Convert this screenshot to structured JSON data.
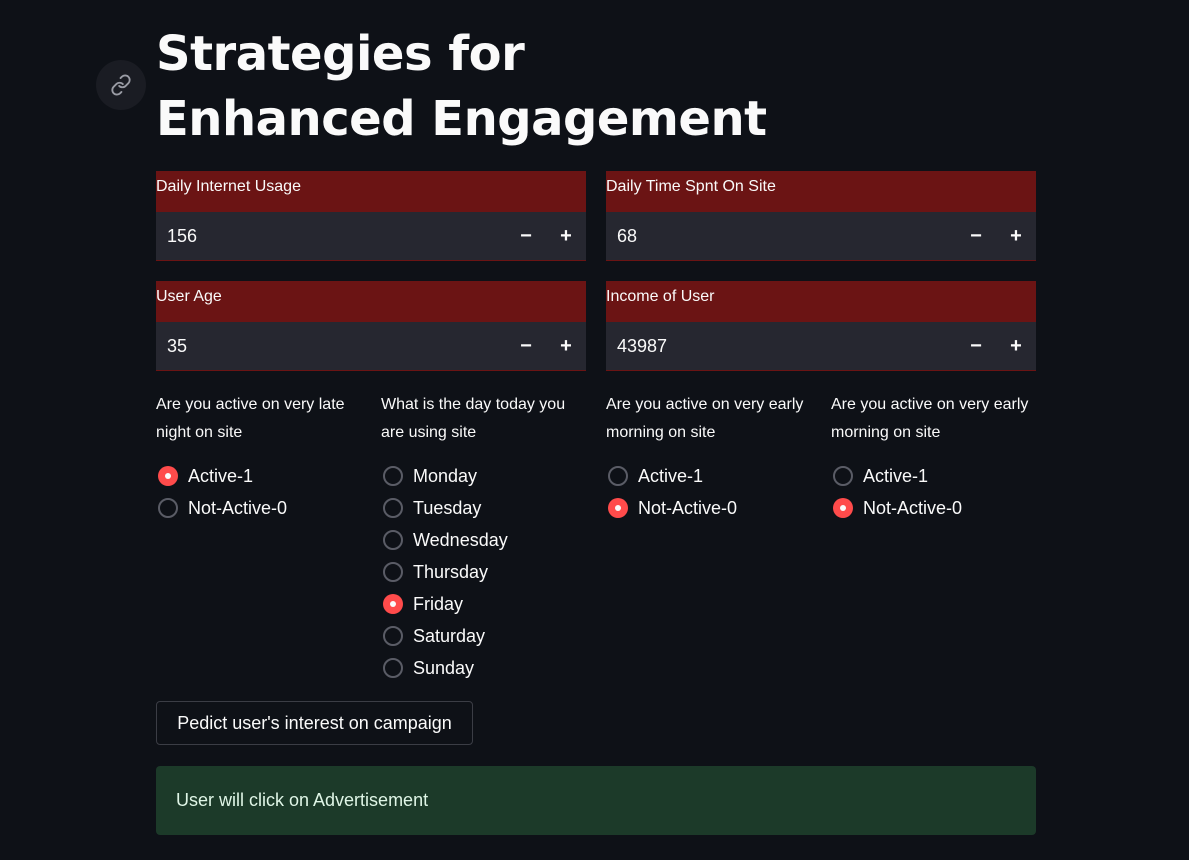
{
  "page": {
    "title": "Strategies for Enhanced Engagement"
  },
  "inputs": [
    {
      "label": "Daily Internet Usage",
      "value": "156",
      "minus": "−",
      "plus": "+"
    },
    {
      "label": "Daily Time Spnt On Site",
      "value": "68",
      "minus": "−",
      "plus": "+"
    },
    {
      "label": "User Age",
      "value": "35",
      "minus": "−",
      "plus": "+"
    },
    {
      "label": "Income of User",
      "value": "43987",
      "minus": "−",
      "plus": "+"
    }
  ],
  "radios": [
    {
      "label": "Are you active on very late night on site",
      "options": [
        "Active-1",
        "Not-Active-0"
      ],
      "selected": 0
    },
    {
      "label": "What is the day today you are using site",
      "options": [
        "Monday",
        "Tuesday",
        "Wednesday",
        "Thursday",
        "Friday",
        "Saturday",
        "Sunday"
      ],
      "selected": 4
    },
    {
      "label": "Are you active on very early morning on site",
      "options": [
        "Active-1",
        "Not-Active-0"
      ],
      "selected": 1
    },
    {
      "label": "Are you active on very early morning on site",
      "options": [
        "Active-1",
        "Not-Active-0"
      ],
      "selected": 1
    }
  ],
  "button": {
    "label": "Pedict user's interest on campaign"
  },
  "result": {
    "text": "User will click on Advertisement"
  },
  "colors": {
    "background": "#0e1117",
    "label_band": "#6b1414",
    "input_bg": "#262730",
    "accent": "#ff4b4b",
    "success_bg": "#1c3a29"
  },
  "icons": {
    "anchor": "link-icon"
  }
}
